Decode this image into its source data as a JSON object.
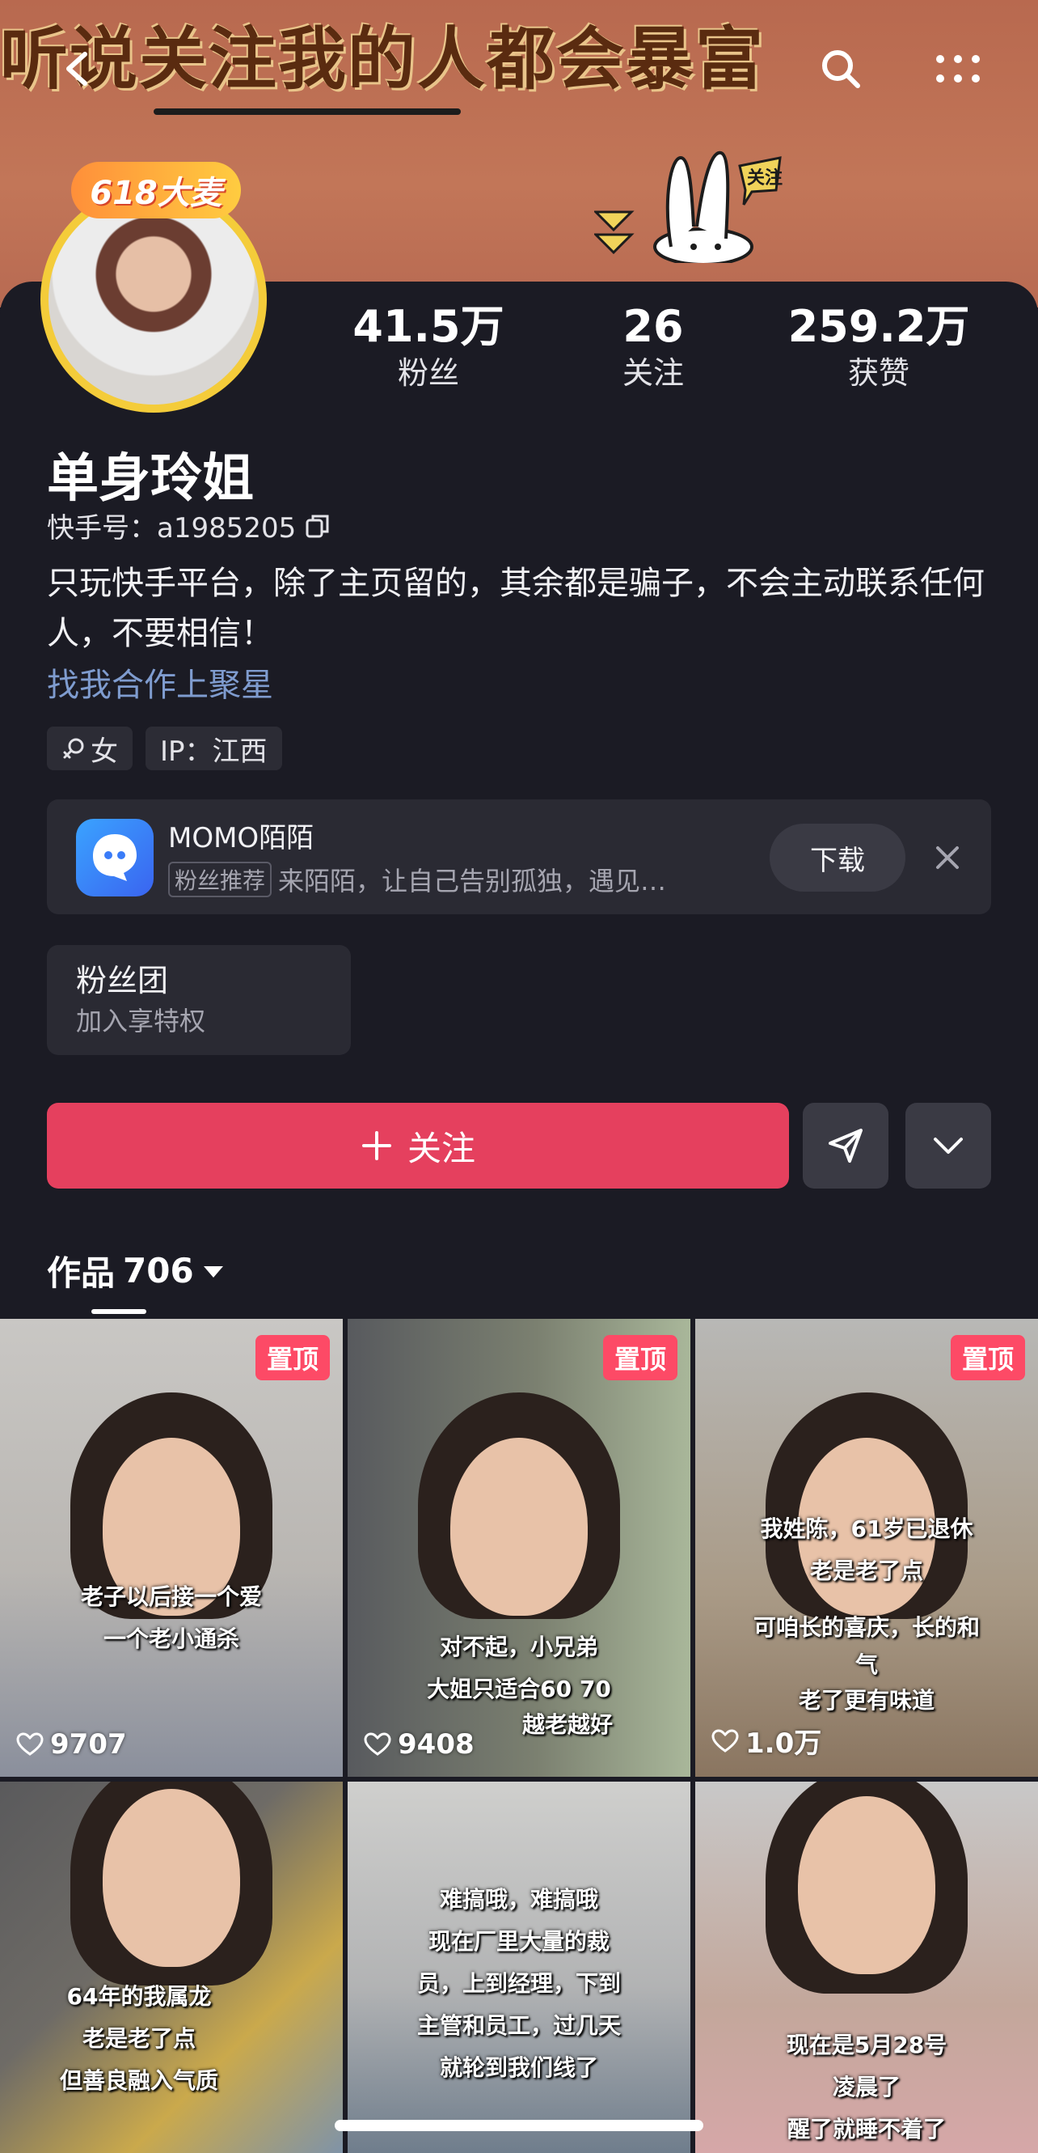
{
  "banner": {
    "slogan": "听说关注我的人都会暴富",
    "bunny_tag": "关注"
  },
  "nav": {
    "back_icon": "chevron-left-icon",
    "search_icon": "search-icon",
    "more_icon": "more-dots-icon"
  },
  "profile": {
    "avatar_badge": "618大麦",
    "stats": [
      {
        "num": "41.5万",
        "label": "粉丝"
      },
      {
        "num": "26",
        "label": "关注"
      },
      {
        "num": "259.2万",
        "label": "获赞"
      }
    ],
    "name": "单身玲姐",
    "kuaishou_id": "快手号：a1985205",
    "bio": "只玩快手平台，除了主页留的，其余都是骗子，不会主动联系任何人，不要相信！",
    "bio_link": "找我合作上聚星",
    "tags": [
      "女",
      "IP：江西"
    ]
  },
  "ad": {
    "title": "MOMO陌陌",
    "badge": "粉丝推荐",
    "desc": "来陌陌，让自己告别孤独，遇见…",
    "download": "下载"
  },
  "fan_club": {
    "title": "粉丝团",
    "sub": "加入享特权"
  },
  "actions": {
    "follow": "关注"
  },
  "works": {
    "tab_label": "作品",
    "count": "706"
  },
  "grid": [
    {
      "pinned": "置顶",
      "caption": [
        "老子以后接一个爱",
        "一个老小通杀"
      ],
      "likes": "9707"
    },
    {
      "pinned": "置顶",
      "caption": [
        "对不起，小兄弟",
        "大姐只适合60 70",
        "越老越好"
      ],
      "likes": "9408"
    },
    {
      "pinned": "置顶",
      "caption": [
        "我姓陈，61岁已退休",
        "老是老了点",
        "可咱长的喜庆，长的和",
        "气",
        "老了更有味道"
      ],
      "likes": "1.0万"
    },
    {
      "pinned": "",
      "caption": [
        "64年的我属龙",
        "老是老了点",
        "但善良融入气质"
      ],
      "likes": ""
    },
    {
      "pinned": "",
      "caption": [
        "难搞哦，难搞哦",
        "现在厂里大量的裁",
        "员，上到经理，下到",
        "主管和员工，过几天",
        "就轮到我们线了"
      ],
      "likes": ""
    },
    {
      "pinned": "",
      "caption": [
        "现在是5月28号",
        "凌晨了",
        "醒了就睡不着了"
      ],
      "likes": ""
    }
  ]
}
